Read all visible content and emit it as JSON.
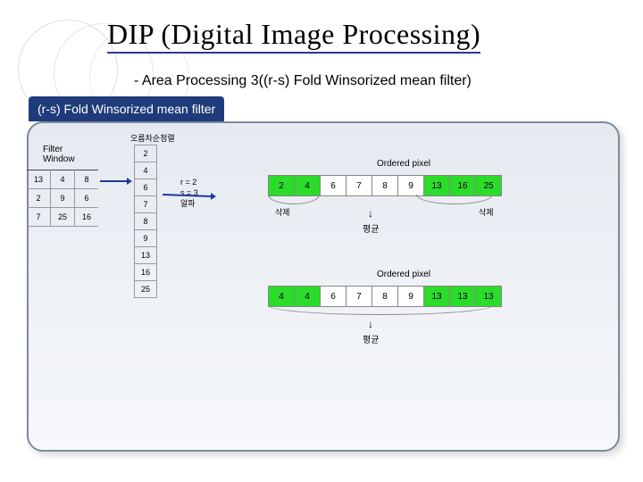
{
  "title": "DIP (Digital Image Processing)",
  "subtitle": "- Area Processing 3((r-s) Fold Winsorized mean filter)",
  "tab_label": "(r-s) Fold Winsorized mean filter",
  "filter_window": {
    "label": "Filter\nWindow",
    "rows": [
      [
        "13",
        "4",
        "8"
      ],
      [
        "2",
        "9",
        "6"
      ],
      [
        "7",
        "25",
        "16"
      ]
    ]
  },
  "sorted_column": {
    "label": "오름차순정렬",
    "values": [
      "2",
      "4",
      "6",
      "7",
      "8",
      "9",
      "13",
      "16",
      "25"
    ]
  },
  "rs_note": {
    "r": "r = 2",
    "s": "s = 3",
    "alpha": "알파"
  },
  "ordered1": {
    "label": "Ordered pixel",
    "left_side": "삭제",
    "right_side": "삭제",
    "cells": [
      "2",
      "4",
      "6",
      "7",
      "8",
      "9",
      "13",
      "16",
      "25"
    ],
    "green": [
      0,
      1,
      6,
      7,
      8
    ],
    "down": "↓",
    "avg": "평균"
  },
  "ordered2": {
    "label": "Ordered pixel",
    "cells": [
      "4",
      "4",
      "6",
      "7",
      "8",
      "9",
      "13",
      "13",
      "13"
    ],
    "green": [
      0,
      1,
      6,
      7,
      8
    ],
    "down": "↓",
    "avg": "평균"
  },
  "chart_data": {
    "type": "table",
    "filter_window": [
      [
        13,
        4,
        8
      ],
      [
        2,
        9,
        6
      ],
      [
        7,
        25,
        16
      ]
    ],
    "sorted": [
      2,
      4,
      6,
      7,
      8,
      9,
      13,
      16,
      25
    ],
    "r": 2,
    "s": 3,
    "winsorized": [
      4,
      4,
      6,
      7,
      8,
      9,
      13,
      13,
      13
    ]
  }
}
